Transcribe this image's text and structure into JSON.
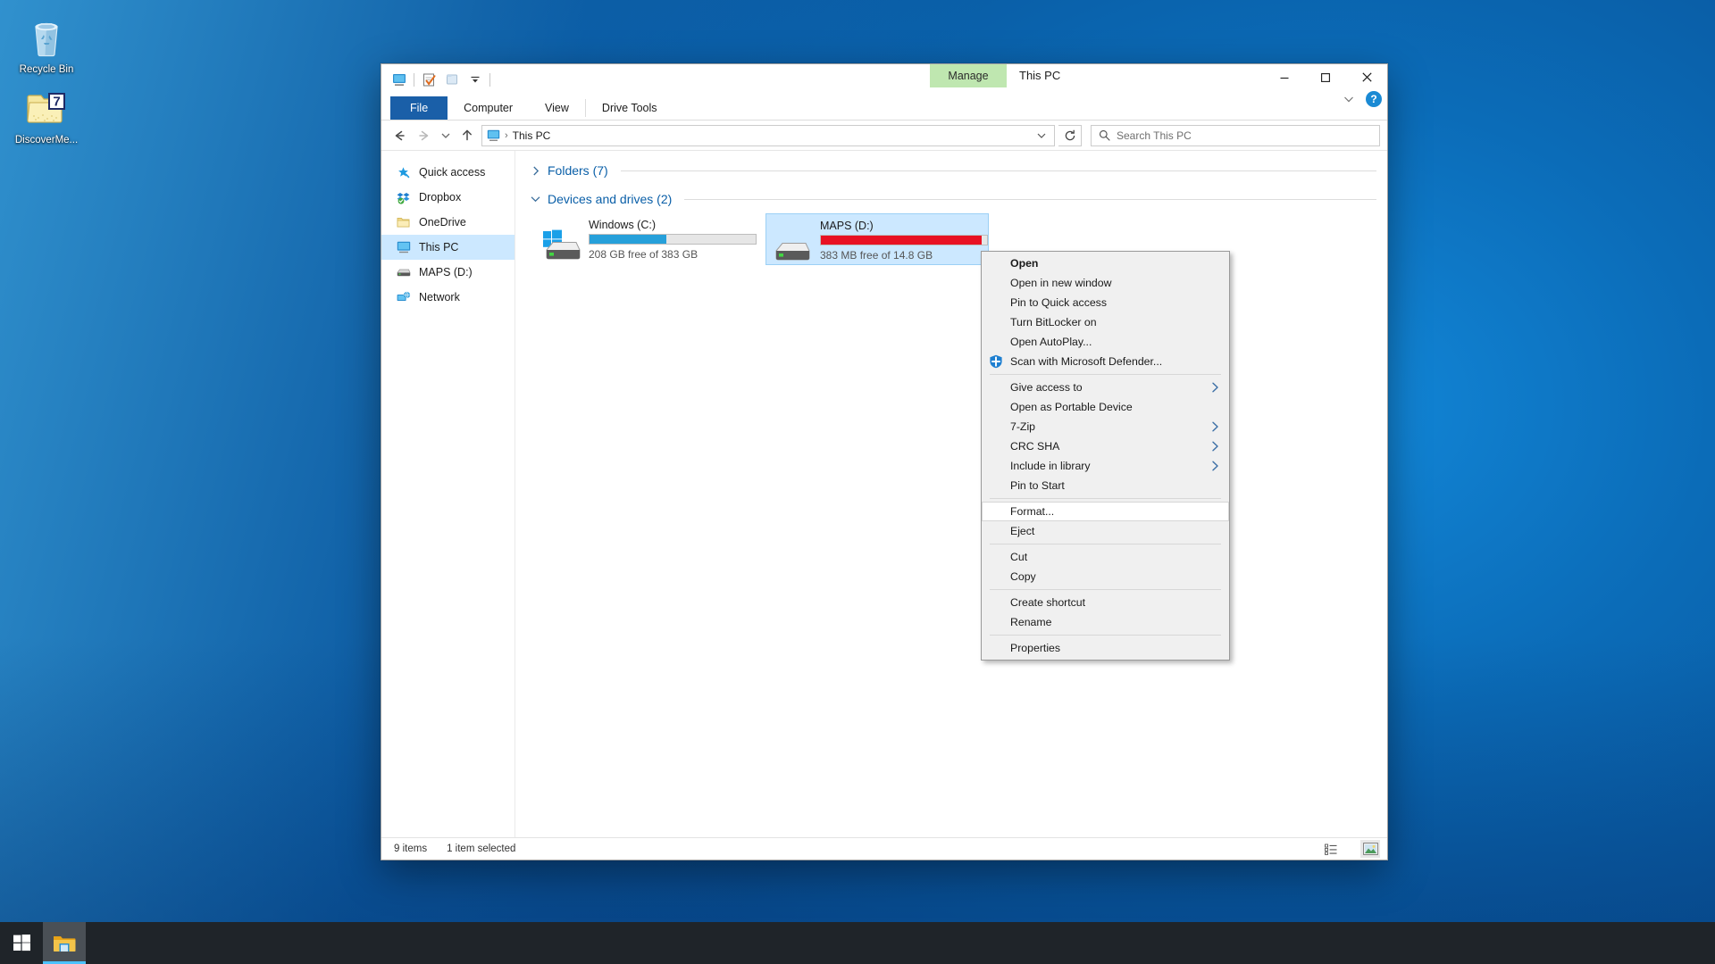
{
  "desktop": {
    "icons": [
      {
        "label": "Recycle Bin",
        "icon": "recycle-bin-icon"
      },
      {
        "label": "DiscoverMe...",
        "icon": "sevenzip-folder-icon"
      }
    ]
  },
  "window": {
    "title": "This PC",
    "quick_access_toolbar": [
      {
        "name": "this-pc-icon",
        "title": "Properties"
      },
      {
        "name": "properties-icon",
        "title": "Properties"
      },
      {
        "name": "new-folder-icon",
        "title": "New folder"
      },
      {
        "name": "customize-dropdown-icon",
        "title": "Customize Quick Access Toolbar"
      }
    ],
    "contextual_tab_group": "Manage",
    "controls": {
      "minimize": "Minimize",
      "maximize": "Maximize",
      "close": "Close",
      "ribbon_expand": "Expand the Ribbon",
      "help": "Help"
    },
    "tabs": [
      {
        "label": "File",
        "active": false,
        "kind": "file"
      },
      {
        "label": "Computer",
        "active": false,
        "kind": "normal"
      },
      {
        "label": "View",
        "active": false,
        "kind": "normal"
      },
      {
        "label": "Drive Tools",
        "active": true,
        "kind": "contextual"
      }
    ]
  },
  "addressbar": {
    "back": "Back",
    "forward": "Forward",
    "recent": "Recent locations",
    "up": "Up",
    "breadcrumb_icon": "this-pc-icon",
    "breadcrumb": "This PC",
    "separator": "›",
    "dropdown": "Previous locations",
    "refresh": "Refresh \"This PC\""
  },
  "search": {
    "placeholder": "Search This PC",
    "value": "",
    "icon": "search-icon"
  },
  "sidebar": {
    "items": [
      {
        "label": "Quick access",
        "icon": "star-pin-icon",
        "selected": false
      },
      {
        "label": "Dropbox",
        "icon": "dropbox-icon",
        "selected": false
      },
      {
        "label": "OneDrive",
        "icon": "onedrive-folder-icon",
        "selected": false
      },
      {
        "label": "This PC",
        "icon": "this-pc-icon",
        "selected": true
      },
      {
        "label": "MAPS (D:)",
        "icon": "drive-icon",
        "selected": false
      },
      {
        "label": "Network",
        "icon": "network-icon",
        "selected": false
      }
    ]
  },
  "content": {
    "groups": [
      {
        "title": "Folders (7)",
        "expanded": false,
        "chevron": "chevron-right-icon"
      },
      {
        "title": "Devices and drives (2)",
        "expanded": true,
        "chevron": "chevron-down-icon"
      }
    ],
    "drives": [
      {
        "name": "Windows (C:)",
        "sub": "208 GB free of 383 GB",
        "used_percent": 46,
        "bar_color": "#26a0da",
        "icon": "windows-drive-icon",
        "selected": false
      },
      {
        "name": "MAPS (D:)",
        "sub": "383 MB free of 14.8 GB",
        "used_percent": 97,
        "bar_color": "#e81123",
        "icon": "drive-icon",
        "selected": true
      }
    ]
  },
  "statusbar": {
    "item_count": "9 items",
    "selection": "1 item selected",
    "view_buttons": [
      {
        "name": "details-view-button",
        "active": false
      },
      {
        "name": "large-icons-view-button",
        "active": true
      }
    ]
  },
  "context_menu": {
    "items": [
      {
        "label": "Open",
        "bold": true,
        "type": "item"
      },
      {
        "label": "Open in new window",
        "type": "item"
      },
      {
        "label": "Pin to Quick access",
        "type": "item"
      },
      {
        "label": "Turn BitLocker on",
        "type": "item"
      },
      {
        "label": "Open AutoPlay...",
        "type": "item"
      },
      {
        "label": "Scan with Microsoft Defender...",
        "type": "item",
        "icon": "defender-shield-icon"
      },
      {
        "type": "separator"
      },
      {
        "label": "Give access to",
        "type": "item",
        "submenu": true
      },
      {
        "label": "Open as Portable Device",
        "type": "item"
      },
      {
        "label": "7-Zip",
        "type": "item",
        "submenu": true
      },
      {
        "label": "CRC SHA",
        "type": "item",
        "submenu": true
      },
      {
        "label": "Include in library",
        "type": "item",
        "submenu": true
      },
      {
        "label": "Pin to Start",
        "type": "item"
      },
      {
        "type": "separator"
      },
      {
        "label": "Format...",
        "type": "item",
        "hovered": true
      },
      {
        "label": "Eject",
        "type": "item"
      },
      {
        "type": "separator"
      },
      {
        "label": "Cut",
        "type": "item"
      },
      {
        "label": "Copy",
        "type": "item"
      },
      {
        "type": "separator"
      },
      {
        "label": "Create shortcut",
        "type": "item"
      },
      {
        "label": "Rename",
        "type": "item"
      },
      {
        "type": "separator"
      },
      {
        "label": "Properties",
        "type": "item"
      }
    ]
  },
  "taskbar": {
    "start": "Start",
    "items": [
      {
        "label": "File Explorer",
        "icon": "file-explorer-icon",
        "active": true
      }
    ]
  },
  "colors": {
    "accent": "#0a5fa8",
    "selection": "#cce8ff",
    "danger": "#e81123",
    "drive_blue": "#26a0da",
    "contextual_tab": "#bfe7b0"
  }
}
